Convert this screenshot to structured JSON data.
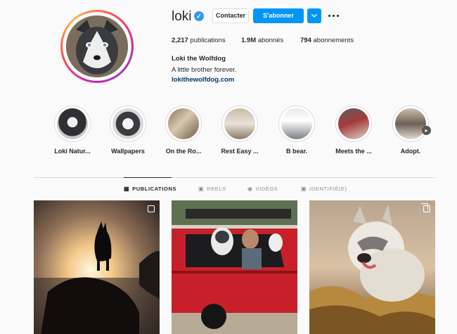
{
  "profile": {
    "username": "loki",
    "verified_glyph": "✓",
    "contact_label": "Contacter",
    "follow_label": "S'abonner",
    "more_icon": "more-horizontal-icon",
    "stats": {
      "posts_count": "2,217",
      "posts_label": "publications",
      "followers_count": "1.9M",
      "followers_label": "abonnés",
      "following_count": "794",
      "following_label": "abonnements"
    },
    "full_name": "Loki the Wolfdog",
    "bio": "A little brother forever.",
    "website": "lokithewolfdog.com"
  },
  "highlights": [
    {
      "label": "Loki Natur..."
    },
    {
      "label": "Wallpapers"
    },
    {
      "label": "On the Ro..."
    },
    {
      "label": "Rest Easy ..."
    },
    {
      "label": "B bear."
    },
    {
      "label": "Meets the ..."
    },
    {
      "label": "Adopt."
    }
  ],
  "tabs": [
    {
      "label": "PUBLICATIONS",
      "icon": "grid-icon",
      "active": true
    },
    {
      "label": "REELS",
      "icon": "reels-icon",
      "active": false
    },
    {
      "label": "VIDÉOS",
      "icon": "video-icon",
      "active": false
    },
    {
      "label": "IDENTIFIÉ(E)",
      "icon": "tagged-icon",
      "active": false
    }
  ],
  "colors": {
    "accent": "#0095f6",
    "link": "#00376b",
    "verified": "#3897f0"
  }
}
